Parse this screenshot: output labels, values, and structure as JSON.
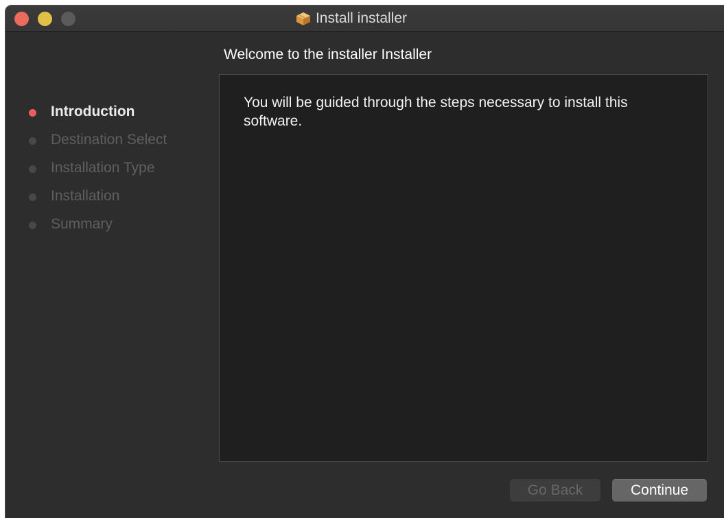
{
  "window": {
    "title": "Install installer",
    "icon": "package-icon"
  },
  "main": {
    "heading": "Welcome to the installer Installer",
    "intro_text": "You will be guided through the steps necessary to install this software."
  },
  "sidebar": {
    "steps": [
      {
        "label": "Introduction",
        "active": true
      },
      {
        "label": "Destination Select",
        "active": false
      },
      {
        "label": "Installation Type",
        "active": false
      },
      {
        "label": "Installation",
        "active": false
      },
      {
        "label": "Summary",
        "active": false
      }
    ]
  },
  "buttons": {
    "back_label": "Go Back",
    "continue_label": "Continue"
  },
  "colors": {
    "active_step_dot": "#ec5d5d",
    "close_button": "#ec6b5e",
    "minimize_button": "#e0c047"
  }
}
